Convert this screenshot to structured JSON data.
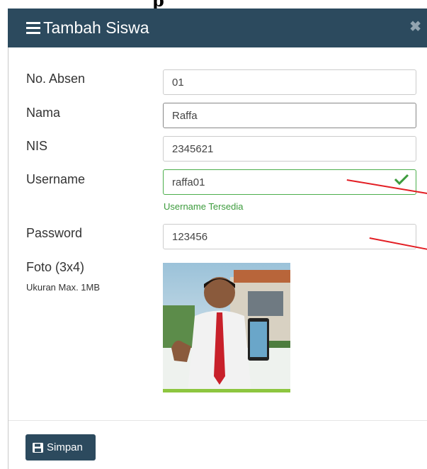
{
  "page": {
    "cut_heading": "p"
  },
  "modal": {
    "title": "Tambah Siswa",
    "close_glyph": "✖"
  },
  "form": {
    "no_absen": {
      "label": "No. Absen",
      "value": "01"
    },
    "nama": {
      "label": "Nama",
      "value": "Raffa"
    },
    "nis": {
      "label": "NIS",
      "value": "2345621"
    },
    "username": {
      "label": "Username",
      "value": "raffa01",
      "status": "Username Tersedia"
    },
    "password": {
      "label": "Password",
      "value": "123456"
    },
    "foto": {
      "label": "Foto (3x4)",
      "hint": "Ukuran Max. 1MB"
    }
  },
  "footer": {
    "save_label": "Simpan"
  },
  "colors": {
    "header_bg": "#2c4a5e",
    "success": "#3c9b3c",
    "annotation": "#e31e24"
  },
  "icons": {
    "menu": "hamburger-icon",
    "close": "close-icon",
    "check": "check-icon",
    "save": "floppy-disk-icon"
  }
}
